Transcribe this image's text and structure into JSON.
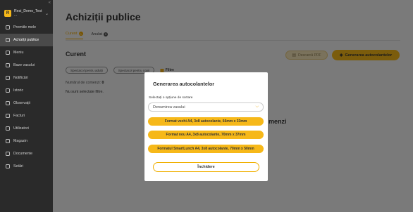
{
  "sidebar": {
    "collapse_icon": "collapse-icon",
    "brand": {
      "logo_letter": "R",
      "name": "Resi_Demo_Test ...",
      "chevron": "⌄"
    },
    "items": [
      {
        "label": "Premiile mele",
        "icon": "award-icon",
        "active": false
      },
      {
        "label": "Achiziții publice",
        "icon": "cart-icon",
        "active": true
      },
      {
        "label": "Meniu",
        "icon": "menu-icon",
        "active": false
      },
      {
        "label": "Baze vasului",
        "icon": "pot-icon",
        "active": false
      },
      {
        "label": "Notificări",
        "icon": "bell-icon",
        "active": false
      },
      {
        "label": "Istoric",
        "icon": "history-icon",
        "active": false
      },
      {
        "label": "Observații",
        "icon": "star-icon",
        "active": false
      },
      {
        "label": "Facturi",
        "icon": "invoice-icon",
        "active": false
      },
      {
        "label": "Utilizatori",
        "icon": "users-icon",
        "active": false
      },
      {
        "label": "Magazin",
        "icon": "shop-icon",
        "active": false
      },
      {
        "label": "Documente",
        "icon": "document-icon",
        "active": false
      },
      {
        "label": "Setări",
        "icon": "gear-icon",
        "active": false
      }
    ]
  },
  "main": {
    "title": "Achiziții publice",
    "tabs": [
      {
        "label": "Curent",
        "count": "0",
        "active": true
      },
      {
        "label": "Anulat",
        "count": "0",
        "active": false
      }
    ],
    "section_title": "Curent",
    "btn_pdf": "Descarcă PDF",
    "btn_generate": "Generarea autocolantelor",
    "filters": [
      "Spectacol pentru adulți",
      "Spectacol pentru copii"
    ],
    "filter_label": "Filtre",
    "orders_label": "Numărul de comenzi:",
    "orders_count": "0",
    "no_filter": "Nu sunt selectate filtre.",
    "bg_side_text": "menzi"
  },
  "modal": {
    "title": "Generarea autocolantelor",
    "sort_label": "Selectați o opțiune de sortare",
    "select_value": "Denumirea vasului",
    "options": [
      "Format vechi A4, 3x8 autocolante, 66mm x 33mm",
      "Format nou A4, 3x8 autocolante, 70mm x 37mm",
      "Formatul SmartLunch A4, 3x8 autocolante, 70mm x 50mm"
    ],
    "close_label": "Închidere"
  },
  "colors": {
    "accent": "#f6b819",
    "sidebar_bg": "#2a2a2a",
    "overlay": "rgba(0,0,0,0.5)"
  }
}
